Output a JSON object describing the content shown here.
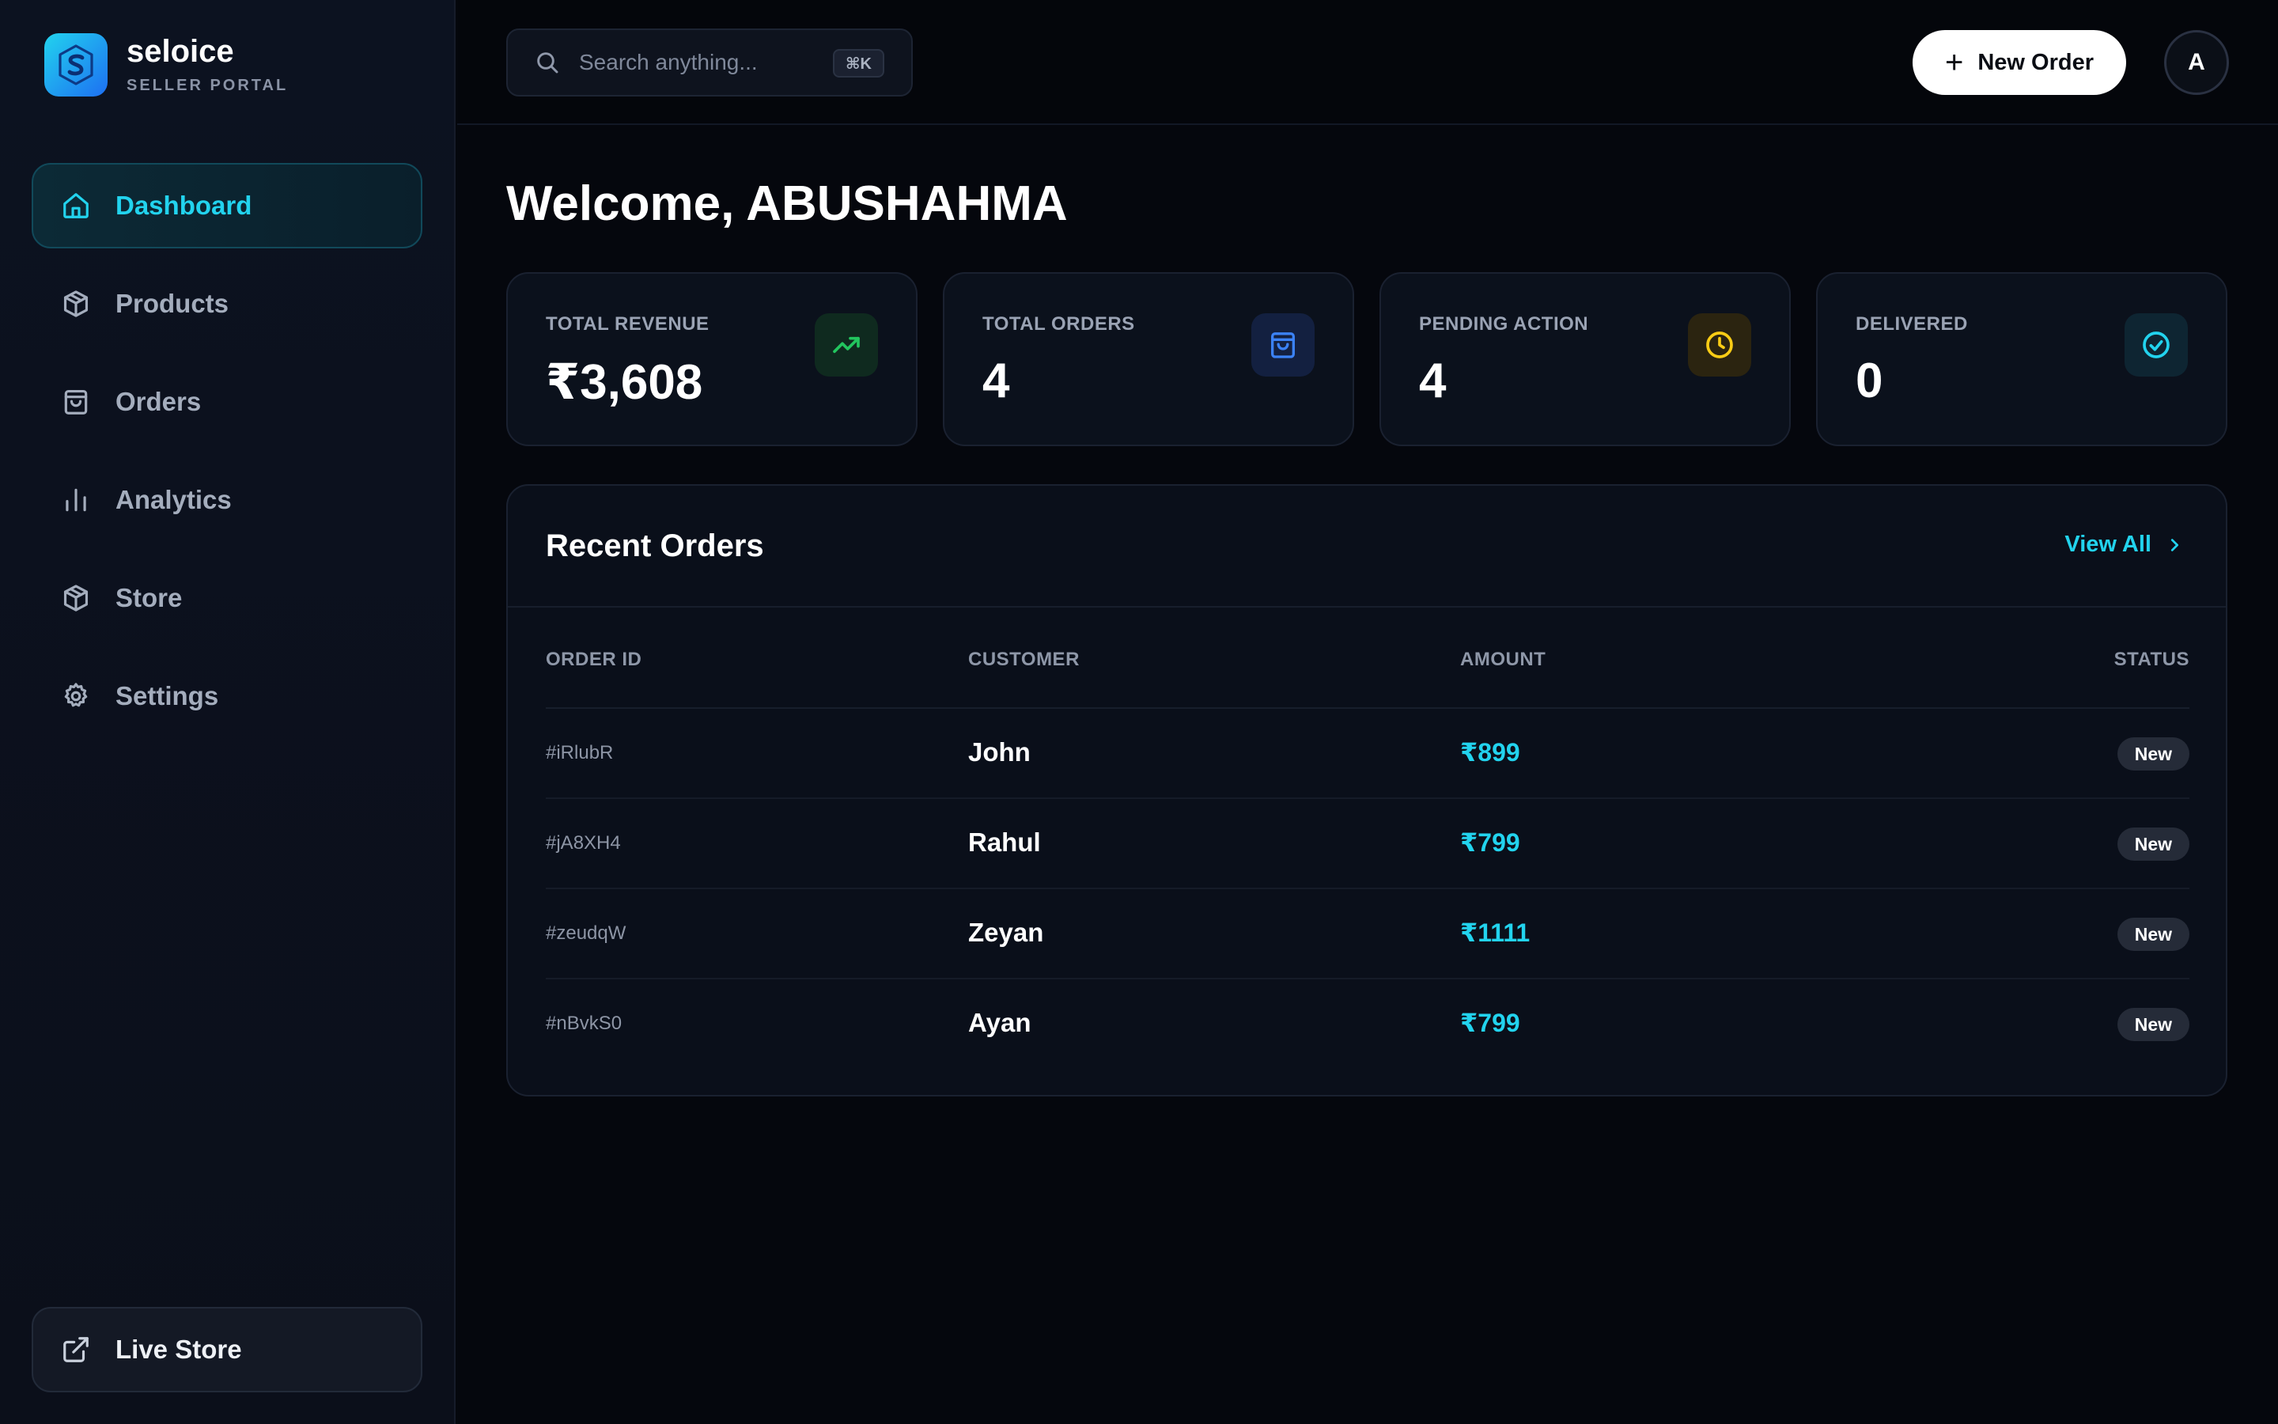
{
  "brand": {
    "name": "seloice",
    "subtitle": "SELLER PORTAL"
  },
  "sidebar": {
    "items": [
      {
        "label": "Dashboard",
        "icon": "home-icon",
        "active": true
      },
      {
        "label": "Products",
        "icon": "package-icon",
        "active": false
      },
      {
        "label": "Orders",
        "icon": "shopping-bag-icon",
        "active": false
      },
      {
        "label": "Analytics",
        "icon": "bar-chart-icon",
        "active": false
      },
      {
        "label": "Store",
        "icon": "package-icon",
        "active": false
      },
      {
        "label": "Settings",
        "icon": "gear-icon",
        "active": false
      }
    ],
    "live_store": {
      "label": "Live Store",
      "icon": "external-link-icon"
    }
  },
  "topbar": {
    "search": {
      "placeholder": "Search anything...",
      "value": "",
      "shortcut": "⌘K"
    },
    "new_order_label": "New Order",
    "avatar_initial": "A"
  },
  "main": {
    "welcome": "Welcome, ABUSHAHMA",
    "stats": [
      {
        "label": "TOTAL REVENUE",
        "value": "₹3,608",
        "icon": "trending-up-icon",
        "color": "#22c55e"
      },
      {
        "label": "TOTAL ORDERS",
        "value": "4",
        "icon": "shopping-bag-icon",
        "color": "#3b82f6"
      },
      {
        "label": "PENDING ACTION",
        "value": "4",
        "icon": "clock-icon",
        "color": "#facc15"
      },
      {
        "label": "DELIVERED",
        "value": "0",
        "icon": "check-circle-icon",
        "color": "#22d3ee"
      }
    ],
    "recent_orders": {
      "title": "Recent Orders",
      "view_all_label": "View All",
      "columns": [
        "ORDER ID",
        "CUSTOMER",
        "AMOUNT",
        "STATUS"
      ],
      "rows": [
        {
          "id": "#iRlubR",
          "customer": "John",
          "amount": "₹899",
          "status": "New"
        },
        {
          "id": "#jA8XH4",
          "customer": "Rahul",
          "amount": "₹799",
          "status": "New"
        },
        {
          "id": "#zeudqW",
          "customer": "Zeyan",
          "amount": "₹1111",
          "status": "New"
        },
        {
          "id": "#nBvkS0",
          "customer": "Ayan",
          "amount": "₹799",
          "status": "New"
        }
      ]
    }
  },
  "colors": {
    "accent": "#22d3ee",
    "background": "#05070d"
  }
}
